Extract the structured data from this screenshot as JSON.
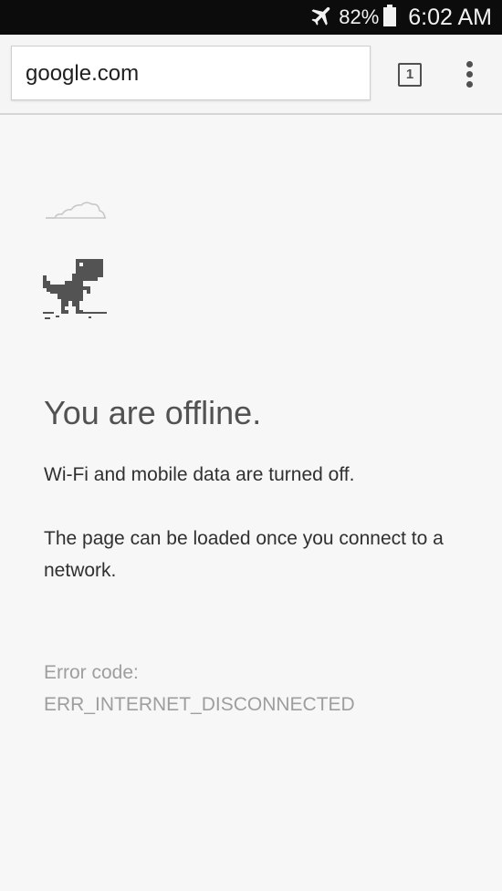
{
  "status_bar": {
    "battery_percent": "82%",
    "time": "6:02 AM",
    "icons": [
      "airplane-mode-icon",
      "battery-icon"
    ]
  },
  "toolbar": {
    "url": "google.com",
    "tab_count": "1",
    "menu_icon": "overflow-menu-icon"
  },
  "error_page": {
    "title": "You are offline.",
    "message_1": "Wi-Fi and mobile data are turned off.",
    "message_2": "The page can be loaded once you connect to a network.",
    "error_label": "Error code:",
    "error_code": "ERR_INTERNET_DISCONNECTED",
    "illustration_icons": [
      "cloud-icon",
      "dinosaur-icon"
    ]
  },
  "colors": {
    "status_bar_bg": "#0c0c0c",
    "page_bg": "#f7f7f7",
    "title_text": "#525252",
    "body_text": "#303030",
    "muted_text": "#9e9e9e"
  }
}
